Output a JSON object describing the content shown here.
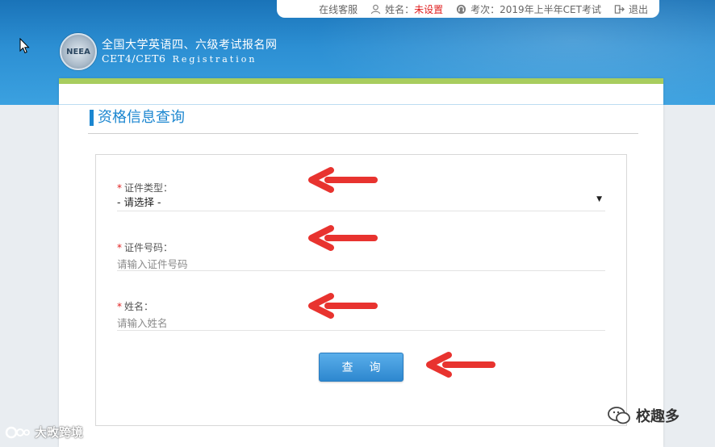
{
  "topbar": {
    "service_label": "在线客服",
    "name_label": "姓名：",
    "name_value": "未设置",
    "exam_label": "考次：",
    "exam_value": "2019年上半年CET考试",
    "logout_label": "退出"
  },
  "brand": {
    "title_cn": "全国大学英语四、六级考试报名网",
    "title_en": "CET4/CET6",
    "subtitle_en": "Registration",
    "seal_text": "NEEA"
  },
  "page": {
    "section_title": "资格信息查询"
  },
  "form": {
    "id_type": {
      "label": "证件类型：",
      "required_mark": "*",
      "value": "- 请选择 -",
      "caret": "▼"
    },
    "id_number": {
      "label": "证件号码：",
      "required_mark": "*",
      "placeholder": "请输入证件号码"
    },
    "name": {
      "label": "姓名：",
      "required_mark": "*",
      "placeholder": "请输入姓名"
    },
    "submit_label": "查询"
  },
  "watermarks": {
    "left": "大畋跨境",
    "right": "校趣多"
  },
  "colors": {
    "accent_blue": "#1b86d0",
    "header_blue": "#2c8fd3",
    "green_bar": "#a8cd5e",
    "required_red": "#e02020",
    "arrow_red": "#e8332f"
  },
  "icons": {
    "service": "user-icon",
    "exam": "headset-icon",
    "logout": "logout-icon",
    "cursor": "mouse-pointer-icon",
    "annotation": "red-arrow-icon"
  }
}
